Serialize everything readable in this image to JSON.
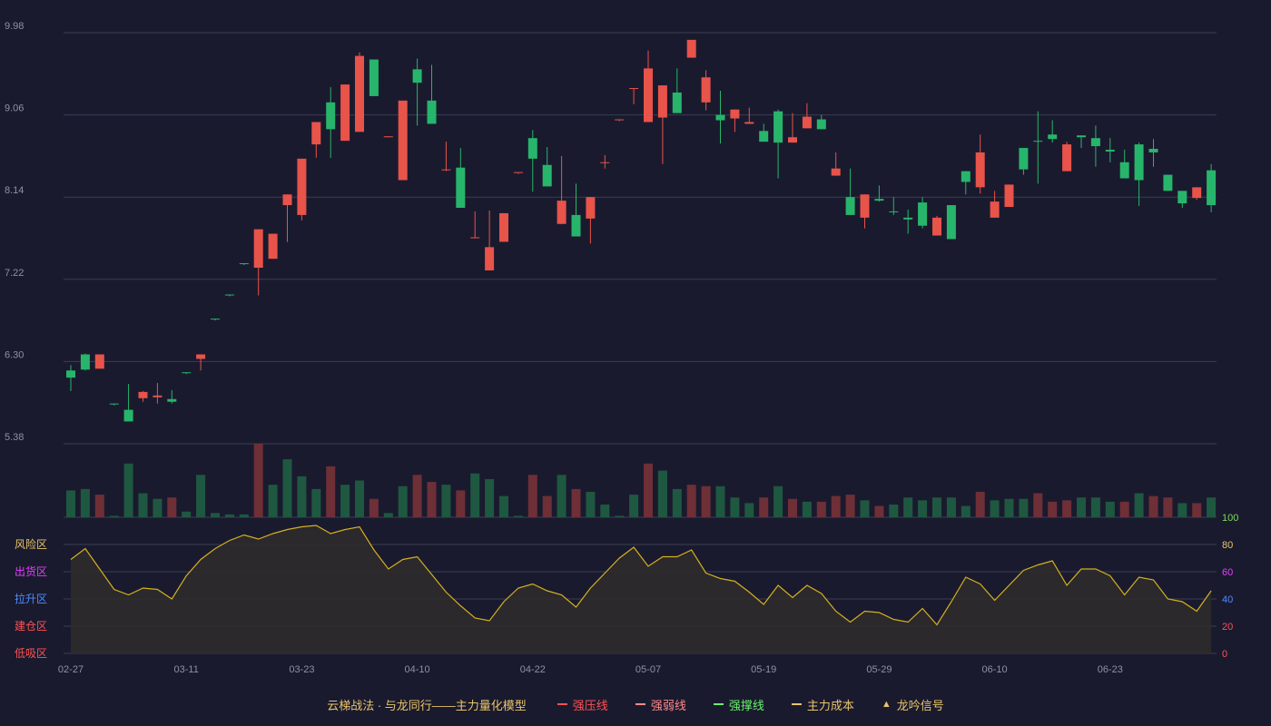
{
  "chart_data": {
    "type": "candlestick",
    "price_axis": {
      "ticks": [
        "9.98",
        "9.06",
        "8.14",
        "7.22",
        "6.30",
        "5.38"
      ],
      "min": 5.38,
      "max": 9.98
    },
    "osc_axis": {
      "ticks": [
        "100",
        "80",
        "60",
        "40",
        "20",
        "0"
      ],
      "min": 0,
      "max": 100
    },
    "zones": [
      {
        "label": "风险区",
        "color": "#e8c46a"
      },
      {
        "label": "出货区",
        "color": "#e040fb"
      },
      {
        "label": "拉升区",
        "color": "#4e8cff"
      },
      {
        "label": "建仓区",
        "color": "#ff5252"
      },
      {
        "label": "低吸区",
        "color": "#ff5252"
      }
    ],
    "x_labels": [
      "02-27",
      "03-11",
      "03-23",
      "04-10",
      "04-22",
      "05-07",
      "05-19",
      "05-29",
      "06-10",
      "06-23"
    ],
    "x_label_indices": [
      0,
      8,
      16,
      24,
      32,
      40,
      48,
      56,
      64,
      72
    ],
    "candles": [
      [
        6.2,
        6.12,
        6.26,
        5.97
      ],
      [
        6.38,
        6.21,
        6.39,
        6.2
      ],
      [
        6.22,
        6.38,
        6.38,
        6.22
      ],
      [
        5.83,
        5.82,
        5.83,
        5.81
      ],
      [
        5.76,
        5.63,
        6.05,
        5.63
      ],
      [
        5.89,
        5.96,
        5.97,
        5.85
      ],
      [
        5.9,
        5.92,
        6.06,
        5.83
      ],
      [
        5.88,
        5.85,
        5.98,
        5.83
      ],
      [
        6.18,
        6.17,
        6.18,
        6.16
      ],
      [
        6.33,
        6.38,
        6.38,
        6.2
      ],
      [
        6.78,
        6.77,
        6.78,
        6.76
      ],
      [
        7.05,
        7.04,
        7.05,
        7.03
      ],
      [
        7.4,
        7.39,
        7.4,
        7.38
      ],
      [
        7.35,
        7.78,
        7.78,
        7.04
      ],
      [
        7.45,
        7.73,
        7.73,
        7.45
      ],
      [
        8.05,
        8.17,
        8.17,
        7.64
      ],
      [
        7.94,
        8.57,
        8.57,
        7.88
      ],
      [
        8.73,
        8.98,
        8.98,
        8.58
      ],
      [
        9.2,
        8.9,
        9.37,
        8.58
      ],
      [
        8.77,
        9.4,
        9.4,
        8.77
      ],
      [
        8.87,
        9.72,
        9.76,
        8.87
      ],
      [
        9.68,
        9.27,
        9.68,
        9.27
      ],
      [
        8.82,
        8.82,
        8.82,
        8.81
      ],
      [
        8.33,
        9.22,
        9.22,
        8.33
      ],
      [
        9.57,
        9.42,
        9.69,
        8.94
      ],
      [
        9.22,
        8.96,
        9.62,
        8.96
      ],
      [
        8.44,
        8.45,
        8.76,
        8.43
      ],
      [
        8.47,
        8.02,
        8.69,
        8.02
      ],
      [
        7.68,
        7.69,
        7.98,
        7.68
      ],
      [
        7.32,
        7.58,
        7.99,
        7.32
      ],
      [
        7.64,
        7.96,
        7.96,
        7.64
      ],
      [
        8.41,
        8.42,
        8.41,
        8.4
      ],
      [
        8.8,
        8.57,
        8.89,
        8.2
      ],
      [
        8.5,
        8.26,
        8.7,
        8.26
      ],
      [
        7.84,
        8.1,
        8.6,
        7.84
      ],
      [
        7.94,
        7.7,
        8.29,
        7.7
      ],
      [
        7.9,
        8.14,
        8.14,
        7.62
      ],
      [
        8.52,
        8.53,
        8.61,
        8.46
      ],
      [
        9.0,
        9.01,
        9.0,
        8.99
      ],
      [
        9.36,
        9.36,
        9.36,
        9.18
      ],
      [
        8.98,
        9.58,
        9.78,
        8.98
      ],
      [
        9.03,
        9.39,
        9.39,
        8.51
      ],
      [
        9.31,
        9.08,
        9.58,
        9.08
      ],
      [
        9.7,
        9.9,
        9.9,
        9.7
      ],
      [
        9.2,
        9.48,
        9.56,
        9.11
      ],
      [
        9.06,
        9.0,
        9.33,
        8.74
      ],
      [
        9.02,
        9.12,
        9.12,
        8.87
      ],
      [
        8.96,
        8.98,
        9.14,
        8.98
      ],
      [
        8.88,
        8.76,
        8.96,
        8.76
      ],
      [
        9.1,
        8.75,
        9.12,
        8.35
      ],
      [
        8.75,
        8.81,
        9.08,
        8.75
      ],
      [
        8.91,
        9.04,
        9.19,
        8.91
      ],
      [
        9.01,
        8.9,
        9.06,
        8.9
      ],
      [
        8.38,
        8.46,
        8.64,
        8.38
      ],
      [
        8.14,
        7.94,
        8.46,
        7.94
      ],
      [
        7.91,
        8.17,
        8.17,
        7.79
      ],
      [
        8.12,
        8.1,
        8.27,
        8.09
      ],
      [
        7.98,
        7.97,
        8.14,
        7.94
      ],
      [
        7.91,
        7.89,
        8.0,
        7.73
      ],
      [
        8.08,
        7.82,
        8.14,
        7.79
      ],
      [
        7.71,
        7.91,
        7.93,
        7.71
      ],
      [
        8.05,
        7.67,
        8.05,
        7.67
      ],
      [
        8.43,
        8.31,
        8.43,
        8.17
      ],
      [
        8.25,
        8.64,
        8.84,
        8.18
      ],
      [
        7.91,
        8.09,
        8.21,
        7.91
      ],
      [
        8.03,
        8.28,
        8.28,
        8.03
      ],
      [
        8.69,
        8.45,
        8.69,
        8.39
      ],
      [
        8.77,
        8.76,
        9.1,
        8.29
      ],
      [
        8.84,
        8.79,
        9.0,
        8.75
      ],
      [
        8.43,
        8.73,
        8.76,
        8.43
      ],
      [
        8.83,
        8.81,
        8.83,
        8.69
      ],
      [
        8.8,
        8.71,
        8.94,
        8.48
      ],
      [
        8.67,
        8.65,
        8.8,
        8.53
      ],
      [
        8.53,
        8.35,
        8.67,
        8.35
      ],
      [
        8.73,
        8.33,
        8.75,
        8.04
      ],
      [
        8.68,
        8.64,
        8.79,
        8.48
      ],
      [
        8.39,
        8.21,
        8.39,
        8.21
      ],
      [
        8.21,
        8.07,
        8.21,
        8.02
      ],
      [
        8.13,
        8.25,
        8.25,
        8.11
      ],
      [
        8.44,
        8.05,
        8.51,
        7.97
      ]
    ],
    "volume": [
      [
        19,
        "g"
      ],
      [
        20,
        "g"
      ],
      [
        16,
        "r"
      ],
      [
        1,
        "g"
      ],
      [
        38,
        "g"
      ],
      [
        17,
        "g"
      ],
      [
        13,
        "g"
      ],
      [
        14,
        "r"
      ],
      [
        4,
        "g"
      ],
      [
        30,
        "g"
      ],
      [
        3,
        "g"
      ],
      [
        2,
        "g"
      ],
      [
        2,
        "g"
      ],
      [
        52,
        "r"
      ],
      [
        23,
        "g"
      ],
      [
        41,
        "g"
      ],
      [
        29,
        "g"
      ],
      [
        20,
        "g"
      ],
      [
        36,
        "r"
      ],
      [
        23,
        "g"
      ],
      [
        26,
        "g"
      ],
      [
        13,
        "r"
      ],
      [
        3,
        "g"
      ],
      [
        22,
        "g"
      ],
      [
        30,
        "r"
      ],
      [
        25,
        "r"
      ],
      [
        23,
        "g"
      ],
      [
        19,
        "r"
      ],
      [
        31,
        "g"
      ],
      [
        27,
        "g"
      ],
      [
        15,
        "g"
      ],
      [
        1,
        "g"
      ],
      [
        30,
        "r"
      ],
      [
        15,
        "r"
      ],
      [
        30,
        "g"
      ],
      [
        20,
        "r"
      ],
      [
        18,
        "g"
      ],
      [
        9,
        "g"
      ],
      [
        1,
        "g"
      ],
      [
        16,
        "g"
      ],
      [
        38,
        "r"
      ],
      [
        33,
        "g"
      ],
      [
        20,
        "g"
      ],
      [
        23,
        "r"
      ],
      [
        22,
        "r"
      ],
      [
        22,
        "g"
      ],
      [
        14,
        "g"
      ],
      [
        10,
        "g"
      ],
      [
        14,
        "r"
      ],
      [
        22,
        "g"
      ],
      [
        13,
        "r"
      ],
      [
        11,
        "g"
      ],
      [
        11,
        "r"
      ],
      [
        15,
        "r"
      ],
      [
        16,
        "r"
      ],
      [
        12,
        "g"
      ],
      [
        8,
        "r"
      ],
      [
        9,
        "g"
      ],
      [
        14,
        "g"
      ],
      [
        12,
        "g"
      ],
      [
        14,
        "g"
      ],
      [
        14,
        "g"
      ],
      [
        8,
        "g"
      ],
      [
        18,
        "r"
      ],
      [
        12,
        "g"
      ],
      [
        13,
        "g"
      ],
      [
        13,
        "g"
      ],
      [
        17,
        "r"
      ],
      [
        11,
        "r"
      ],
      [
        12,
        "r"
      ],
      [
        14,
        "g"
      ],
      [
        14,
        "g"
      ],
      [
        11,
        "g"
      ],
      [
        11,
        "r"
      ],
      [
        17,
        "g"
      ],
      [
        15,
        "r"
      ],
      [
        14,
        "r"
      ],
      [
        10,
        "g"
      ],
      [
        10,
        "r"
      ],
      [
        14,
        "g"
      ]
    ],
    "oscillator": [
      69,
      77,
      62,
      47,
      43,
      48,
      47,
      40,
      57,
      69,
      77,
      83,
      87,
      84,
      88,
      91,
      93,
      94,
      88,
      91,
      93,
      76,
      62,
      69,
      71,
      58,
      45,
      35,
      26,
      24,
      38,
      48,
      51,
      46,
      43,
      34,
      48,
      59,
      70,
      78,
      64,
      71,
      71,
      76,
      59,
      55,
      53,
      45,
      36,
      50,
      41,
      50,
      44,
      31,
      23,
      31,
      30,
      25,
      23,
      33,
      21,
      38,
      56,
      51,
      39,
      50,
      61,
      65,
      68,
      50,
      62,
      62,
      57,
      43,
      56,
      54,
      40,
      38,
      31,
      46
    ],
    "legend": {
      "title": "云梯战法 · 与龙同行——主力量化模型",
      "items": [
        {
          "label": "强压线",
          "color": "#ff5252",
          "style": "solid"
        },
        {
          "label": "强弱线",
          "color": "#ff8a8a",
          "style": "dashed"
        },
        {
          "label": "强撑线",
          "color": "#69f06b",
          "style": "solid"
        },
        {
          "label": "主力成本",
          "color": "#e8c46a",
          "style": "dashed"
        },
        {
          "label": "龙吟信号",
          "color": "#e8c46a",
          "style": "triangle"
        }
      ]
    },
    "colors": {
      "up": "#e8534a",
      "down": "#27b56b",
      "vol_up": "#6e2f37",
      "vol_down": "#1e5840",
      "osc_line": "#d4b020",
      "osc_fill": "#2e2b2b",
      "grid": "#3a3d52",
      "axis_text": "#8e91a4",
      "osc_axis_text_top": "#7bd95a"
    }
  }
}
